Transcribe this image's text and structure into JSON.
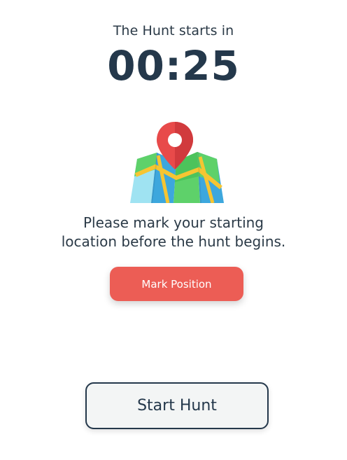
{
  "countdown": {
    "label": "The Hunt starts in",
    "time": "00:25"
  },
  "illustration": {
    "icon": "map-pin-icon"
  },
  "instruction": {
    "line1": "Please mark your starting",
    "line2": "location before the hunt begins."
  },
  "actions": {
    "mark_position_label": "Mark Position",
    "start_hunt_label": "Start Hunt"
  },
  "colors": {
    "accent": "#ec5d55",
    "primary_dark": "#24384b",
    "background": "#ffffff"
  }
}
